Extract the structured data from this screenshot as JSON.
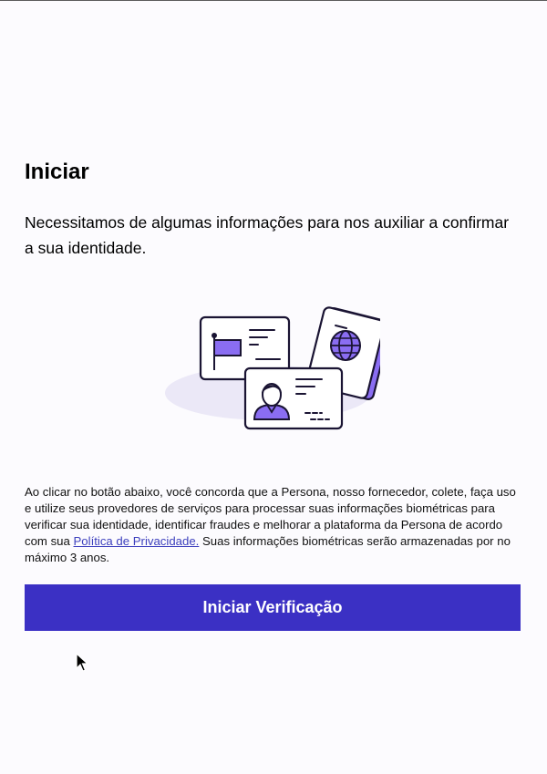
{
  "page": {
    "title": "Iniciar",
    "subtitle": "Necessitamos de algumas informações para nos auxiliar a confirmar a sua identidade."
  },
  "illustration": {
    "icons": [
      "id-card-flag-icon",
      "passport-globe-icon",
      "id-card-person-icon"
    ],
    "accent_color": "#8a6df2",
    "blob_color": "#ebe8f7",
    "outline_color": "#1a1433"
  },
  "consent": {
    "text_before": "Ao clicar no botão abaixo, você concorda que a Persona, nosso fornecedor, colete, faça uso e utilize seus provedores de serviços para processar suas informações biométricas para verificar sua identidade, identificar fraudes e melhorar a plataforma da Persona de acordo com sua ",
    "link_text": "Política de Privacidade.",
    "text_after": " Suas informações biométricas serão armazenadas por no máximo 3 anos."
  },
  "actions": {
    "start_label": "Iniciar Verificação",
    "button_color": "#3b30c4"
  },
  "cursor": {
    "icon": "mouse-pointer-icon"
  }
}
